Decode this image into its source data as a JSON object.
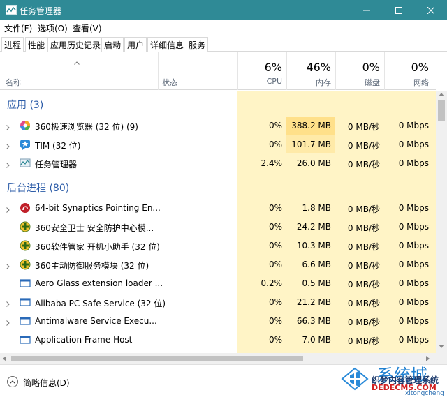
{
  "window": {
    "title": "任务管理器",
    "accent": "#2f8a96",
    "controls": [
      "minimize-icon",
      "maximize-icon",
      "close-icon"
    ]
  },
  "menu": [
    "文件(F)",
    "选项(O)",
    "查看(V)"
  ],
  "tabs": [
    "进程",
    "性能",
    "应用历史记录",
    "启动",
    "用户",
    "详细信息",
    "服务"
  ],
  "active_tab": "进程",
  "columns": {
    "name": "名称",
    "status": "状态",
    "cpu": {
      "pct": "6%",
      "label": "CPU"
    },
    "mem": {
      "pct": "46%",
      "label": "内存"
    },
    "disk": {
      "pct": "0%",
      "label": "磁盘"
    },
    "net": {
      "pct": "0%",
      "label": "网络"
    }
  },
  "groups": {
    "apps": "应用 (3)",
    "background": "后台进程 (80)"
  },
  "apps": [
    {
      "name": "360极速浏览器 (32 位) (9)",
      "icon": "360-browser-icon",
      "expandable": true,
      "cpu": "0%",
      "mem": "388.2 MB",
      "disk": "0 MB/秒",
      "net": "0 Mbps"
    },
    {
      "name": "TIM (32 位)",
      "icon": "tim-icon",
      "expandable": true,
      "cpu": "0%",
      "mem": "101.7 MB",
      "disk": "0 MB/秒",
      "net": "0 Mbps"
    },
    {
      "name": "任务管理器",
      "icon": "task-manager-icon",
      "expandable": true,
      "cpu": "2.4%",
      "mem": "26.0 MB",
      "disk": "0 MB/秒",
      "net": "0 Mbps"
    }
  ],
  "background": [
    {
      "name": "64-bit Synaptics Pointing En...",
      "icon": "synaptics-icon",
      "expandable": true,
      "cpu": "0%",
      "mem": "1.8 MB",
      "disk": "0 MB/秒",
      "net": "0 Mbps"
    },
    {
      "name": "360安全卫士 安全防护中心模...",
      "icon": "360-safe-icon",
      "expandable": false,
      "cpu": "0%",
      "mem": "24.2 MB",
      "disk": "0 MB/秒",
      "net": "0 Mbps"
    },
    {
      "name": "360软件管家 开机小助手 (32 位)",
      "icon": "360-safe-icon",
      "expandable": false,
      "cpu": "0%",
      "mem": "10.3 MB",
      "disk": "0 MB/秒",
      "net": "0 Mbps"
    },
    {
      "name": "360主动防御服务模块 (32 位)",
      "icon": "360-safe-icon",
      "expandable": true,
      "cpu": "0%",
      "mem": "6.6 MB",
      "disk": "0 MB/秒",
      "net": "0 Mbps"
    },
    {
      "name": "Aero Glass extension loader ...",
      "icon": "app-window-icon",
      "expandable": false,
      "cpu": "0.2%",
      "mem": "0.5 MB",
      "disk": "0 MB/秒",
      "net": "0 Mbps"
    },
    {
      "name": "Alibaba PC Safe Service (32 位)",
      "icon": "app-window-icon",
      "expandable": true,
      "cpu": "0%",
      "mem": "21.2 MB",
      "disk": "0 MB/秒",
      "net": "0 Mbps"
    },
    {
      "name": "Antimalware Service Execu...",
      "icon": "app-window-icon",
      "expandable": true,
      "cpu": "0%",
      "mem": "66.3 MB",
      "disk": "0 MB/秒",
      "net": "0 Mbps"
    },
    {
      "name": "Application Frame Host",
      "icon": "app-window-icon",
      "expandable": false,
      "cpu": "0%",
      "mem": "7.0 MB",
      "disk": "0 MB/秒",
      "net": "0 Mbps"
    }
  ],
  "footer": {
    "fewer_details": "简略信息(D)"
  },
  "colors": {
    "cpu_bg": "#fff4c6",
    "mem_highlight": "#ffe08a",
    "mem_mid": "#ffeaa8",
    "group": "#2c5ca8"
  },
  "watermark": {
    "name": "系统城",
    "tagline": "织梦内容管理系统",
    "site": "DEDECMS.COM",
    "sub": "xitongcheng"
  }
}
